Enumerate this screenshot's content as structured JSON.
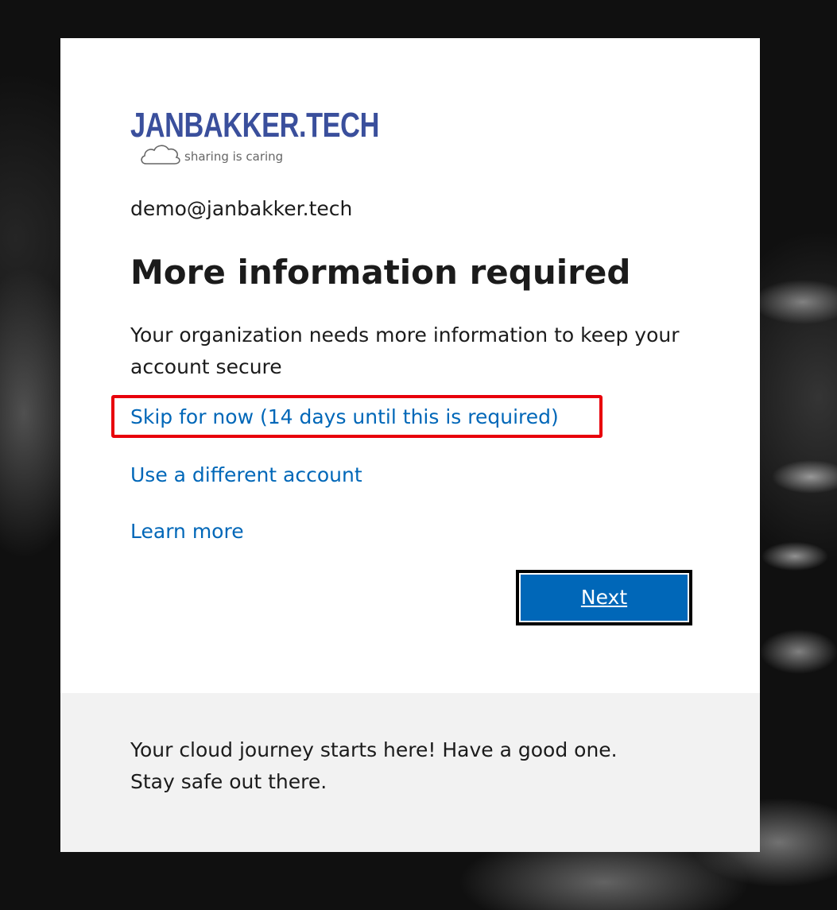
{
  "logo": {
    "brand": "JANBAKKER.TECH",
    "tagline": "sharing is caring",
    "brand_color": "#3a4f9c"
  },
  "account": {
    "email": "demo@janbakker.tech"
  },
  "main": {
    "title": "More information required",
    "description": "Your organization needs more information to keep your account secure",
    "links": {
      "skip": "Skip for now (14 days until this is required)",
      "different_account": "Use a different account",
      "learn_more": "Learn more"
    },
    "next_label": "Next"
  },
  "footer": {
    "line1": "Your cloud journey starts here! Have a good one.",
    "line2": "Stay safe out there."
  },
  "colors": {
    "link": "#0067b8",
    "button": "#0067b8",
    "highlight": "#e8000b",
    "footer_bg": "#f2f2f2"
  }
}
